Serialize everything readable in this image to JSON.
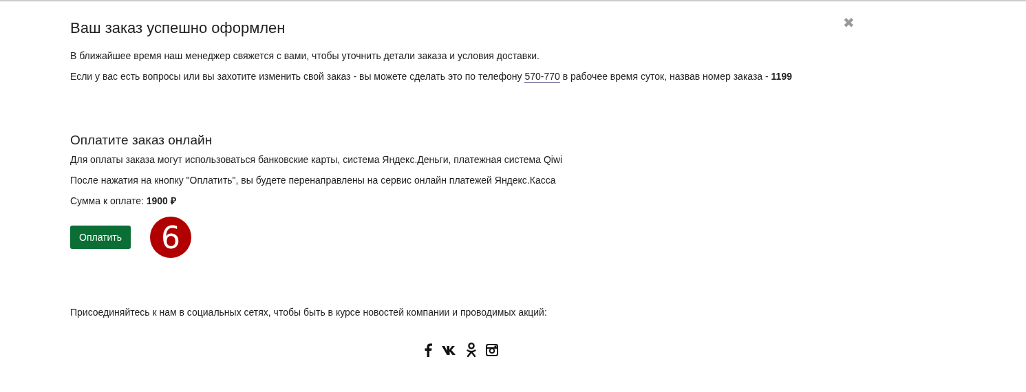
{
  "order": {
    "title": "Ваш заказ успешно оформлен",
    "close": "✖",
    "message": "В ближайшее время наш менеджер свяжется с вами, чтобы уточнить детали заказа и условия доставки.",
    "contact": {
      "before": "Если у вас есть вопросы или вы захотите изменить свой заказ - вы можете сделать это по телефону",
      "phone": "570-770",
      "after": "в рабочее время суток, назвав номер заказа - **1199**"
    }
  },
  "payment": {
    "title": "Оплатите заказ онлайн",
    "lines": [
      "Для оплаты заказа могут использоваться банковские карты, система Яндекс.Деньги, платежная система Qiwi",
      "После нажатия на кнопку \"Оплатить\", вы будете перенаправлены на сервис онлайн платежей Яндекс.Касса"
    ],
    "sum": "Сумма к оплате: **1900 ₽**",
    "button": "Оплатить",
    "badge": "6"
  },
  "social": {
    "text": "Присоединяйтесь к нам в социальных сетях, чтобы быть в курсе новостей компании и проводимых акций:",
    "icons": [
      {
        "kind": "facebook"
      },
      {
        "kind": "vk"
      },
      {
        "kind": "ok"
      },
      {
        "kind": "instagram"
      }
    ]
  }
}
